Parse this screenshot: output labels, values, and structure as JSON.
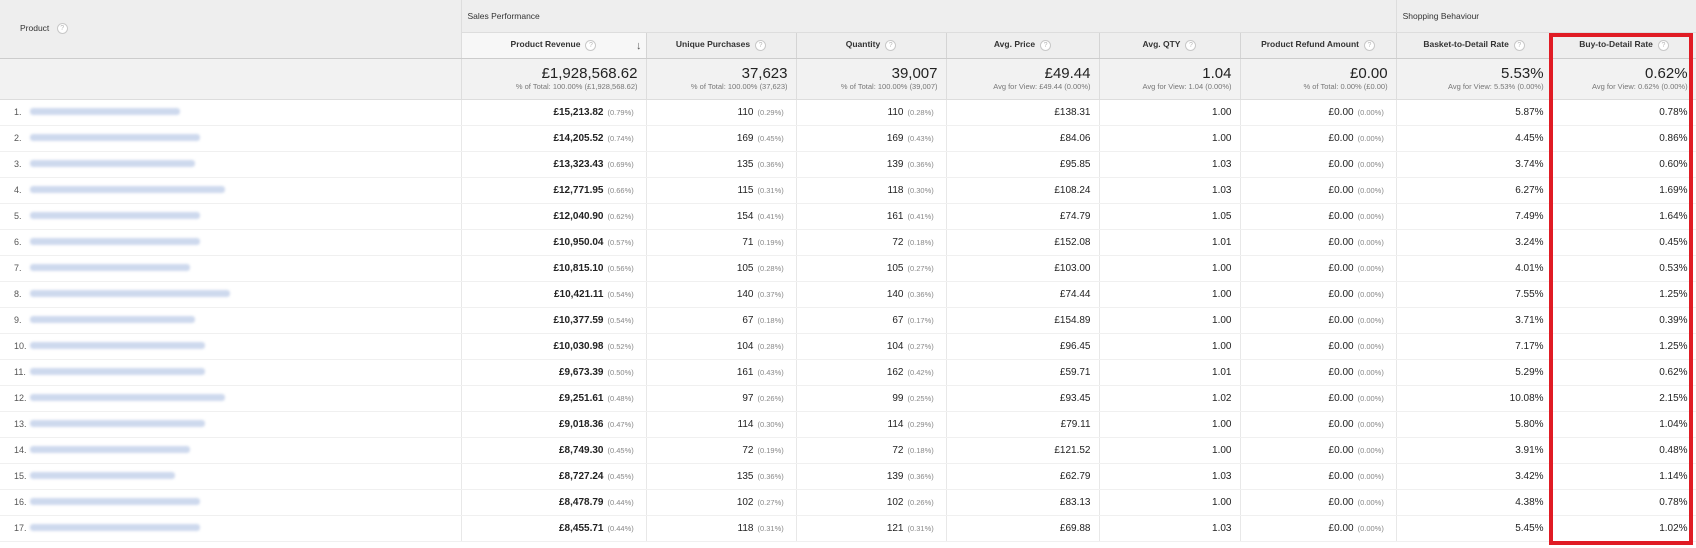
{
  "header": {
    "product": "Product",
    "group_sales": "Sales Performance",
    "group_shopping": "Shopping Behaviour",
    "help_glyph": "?",
    "sort_glyph": "↓"
  },
  "columns": [
    "Product Revenue",
    "Unique Purchases",
    "Quantity",
    "Avg. Price",
    "Avg. QTY",
    "Product Refund Amount",
    "Basket-to-Detail Rate",
    "Buy-to-Detail Rate"
  ],
  "totals": [
    {
      "big": "£1,928,568.62",
      "small": "% of Total: 100.00% (£1,928,568.62)"
    },
    {
      "big": "37,623",
      "small": "% of Total: 100.00% (37,623)"
    },
    {
      "big": "39,007",
      "small": "% of Total: 100.00% (39,007)"
    },
    {
      "big": "£49.44",
      "small": "Avg for View: £49.44 (0.00%)"
    },
    {
      "big": "1.04",
      "small": "Avg for View: 1.04 (0.00%)"
    },
    {
      "big": "£0.00",
      "small": "% of Total: 0.00% (£0.00)"
    },
    {
      "big": "5.53%",
      "small": "Avg for View: 5.53% (0.00%)"
    },
    {
      "big": "0.62%",
      "small": "Avg for View: 0.62% (0.00%)"
    }
  ],
  "rows": [
    {
      "idx": "1.",
      "rev": "£15,213.82",
      "rev_pct": "(0.79%)",
      "up": "110",
      "up_pct": "(0.29%)",
      "qty": "110",
      "qty_pct": "(0.28%)",
      "price": "£138.31",
      "aqty": "1.00",
      "refund": "£0.00",
      "refund_pct": "(0.00%)",
      "btd": "5.87%",
      "buy": "0.78%"
    },
    {
      "idx": "2.",
      "rev": "£14,205.52",
      "rev_pct": "(0.74%)",
      "up": "169",
      "up_pct": "(0.45%)",
      "qty": "169",
      "qty_pct": "(0.43%)",
      "price": "£84.06",
      "aqty": "1.00",
      "refund": "£0.00",
      "refund_pct": "(0.00%)",
      "btd": "4.45%",
      "buy": "0.86%"
    },
    {
      "idx": "3.",
      "rev": "£13,323.43",
      "rev_pct": "(0.69%)",
      "up": "135",
      "up_pct": "(0.36%)",
      "qty": "139",
      "qty_pct": "(0.36%)",
      "price": "£95.85",
      "aqty": "1.03",
      "refund": "£0.00",
      "refund_pct": "(0.00%)",
      "btd": "3.74%",
      "buy": "0.60%"
    },
    {
      "idx": "4.",
      "rev": "£12,771.95",
      "rev_pct": "(0.66%)",
      "up": "115",
      "up_pct": "(0.31%)",
      "qty": "118",
      "qty_pct": "(0.30%)",
      "price": "£108.24",
      "aqty": "1.03",
      "refund": "£0.00",
      "refund_pct": "(0.00%)",
      "btd": "6.27%",
      "buy": "1.69%"
    },
    {
      "idx": "5.",
      "rev": "£12,040.90",
      "rev_pct": "(0.62%)",
      "up": "154",
      "up_pct": "(0.41%)",
      "qty": "161",
      "qty_pct": "(0.41%)",
      "price": "£74.79",
      "aqty": "1.05",
      "refund": "£0.00",
      "refund_pct": "(0.00%)",
      "btd": "7.49%",
      "buy": "1.64%"
    },
    {
      "idx": "6.",
      "rev": "£10,950.04",
      "rev_pct": "(0.57%)",
      "up": "71",
      "up_pct": "(0.19%)",
      "qty": "72",
      "qty_pct": "(0.18%)",
      "price": "£152.08",
      "aqty": "1.01",
      "refund": "£0.00",
      "refund_pct": "(0.00%)",
      "btd": "3.24%",
      "buy": "0.45%"
    },
    {
      "idx": "7.",
      "rev": "£10,815.10",
      "rev_pct": "(0.56%)",
      "up": "105",
      "up_pct": "(0.28%)",
      "qty": "105",
      "qty_pct": "(0.27%)",
      "price": "£103.00",
      "aqty": "1.00",
      "refund": "£0.00",
      "refund_pct": "(0.00%)",
      "btd": "4.01%",
      "buy": "0.53%"
    },
    {
      "idx": "8.",
      "rev": "£10,421.11",
      "rev_pct": "(0.54%)",
      "up": "140",
      "up_pct": "(0.37%)",
      "qty": "140",
      "qty_pct": "(0.36%)",
      "price": "£74.44",
      "aqty": "1.00",
      "refund": "£0.00",
      "refund_pct": "(0.00%)",
      "btd": "7.55%",
      "buy": "1.25%"
    },
    {
      "idx": "9.",
      "rev": "£10,377.59",
      "rev_pct": "(0.54%)",
      "up": "67",
      "up_pct": "(0.18%)",
      "qty": "67",
      "qty_pct": "(0.17%)",
      "price": "£154.89",
      "aqty": "1.00",
      "refund": "£0.00",
      "refund_pct": "(0.00%)",
      "btd": "3.71%",
      "buy": "0.39%"
    },
    {
      "idx": "10.",
      "rev": "£10,030.98",
      "rev_pct": "(0.52%)",
      "up": "104",
      "up_pct": "(0.28%)",
      "qty": "104",
      "qty_pct": "(0.27%)",
      "price": "£96.45",
      "aqty": "1.00",
      "refund": "£0.00",
      "refund_pct": "(0.00%)",
      "btd": "7.17%",
      "buy": "1.25%"
    },
    {
      "idx": "11.",
      "rev": "£9,673.39",
      "rev_pct": "(0.50%)",
      "up": "161",
      "up_pct": "(0.43%)",
      "qty": "162",
      "qty_pct": "(0.42%)",
      "price": "£59.71",
      "aqty": "1.01",
      "refund": "£0.00",
      "refund_pct": "(0.00%)",
      "btd": "5.29%",
      "buy": "0.62%"
    },
    {
      "idx": "12.",
      "rev": "£9,251.61",
      "rev_pct": "(0.48%)",
      "up": "97",
      "up_pct": "(0.26%)",
      "qty": "99",
      "qty_pct": "(0.25%)",
      "price": "£93.45",
      "aqty": "1.02",
      "refund": "£0.00",
      "refund_pct": "(0.00%)",
      "btd": "10.08%",
      "buy": "2.15%"
    },
    {
      "idx": "13.",
      "rev": "£9,018.36",
      "rev_pct": "(0.47%)",
      "up": "114",
      "up_pct": "(0.30%)",
      "qty": "114",
      "qty_pct": "(0.29%)",
      "price": "£79.11",
      "aqty": "1.00",
      "refund": "£0.00",
      "refund_pct": "(0.00%)",
      "btd": "5.80%",
      "buy": "1.04%"
    },
    {
      "idx": "14.",
      "rev": "£8,749.30",
      "rev_pct": "(0.45%)",
      "up": "72",
      "up_pct": "(0.19%)",
      "qty": "72",
      "qty_pct": "(0.18%)",
      "price": "£121.52",
      "aqty": "1.00",
      "refund": "£0.00",
      "refund_pct": "(0.00%)",
      "btd": "3.91%",
      "buy": "0.48%"
    },
    {
      "idx": "15.",
      "rev": "£8,727.24",
      "rev_pct": "(0.45%)",
      "up": "135",
      "up_pct": "(0.36%)",
      "qty": "139",
      "qty_pct": "(0.36%)",
      "price": "£62.79",
      "aqty": "1.03",
      "refund": "£0.00",
      "refund_pct": "(0.00%)",
      "btd": "3.42%",
      "buy": "1.14%"
    },
    {
      "idx": "16.",
      "rev": "£8,478.79",
      "rev_pct": "(0.44%)",
      "up": "102",
      "up_pct": "(0.27%)",
      "qty": "102",
      "qty_pct": "(0.26%)",
      "price": "£83.13",
      "aqty": "1.00",
      "refund": "£0.00",
      "refund_pct": "(0.00%)",
      "btd": "4.38%",
      "buy": "0.78%"
    },
    {
      "idx": "17.",
      "rev": "£8,455.71",
      "rev_pct": "(0.44%)",
      "up": "118",
      "up_pct": "(0.31%)",
      "qty": "121",
      "qty_pct": "(0.31%)",
      "price": "£69.88",
      "aqty": "1.03",
      "refund": "£0.00",
      "refund_pct": "(0.00%)",
      "btd": "5.45%",
      "buy": "1.02%"
    }
  ]
}
